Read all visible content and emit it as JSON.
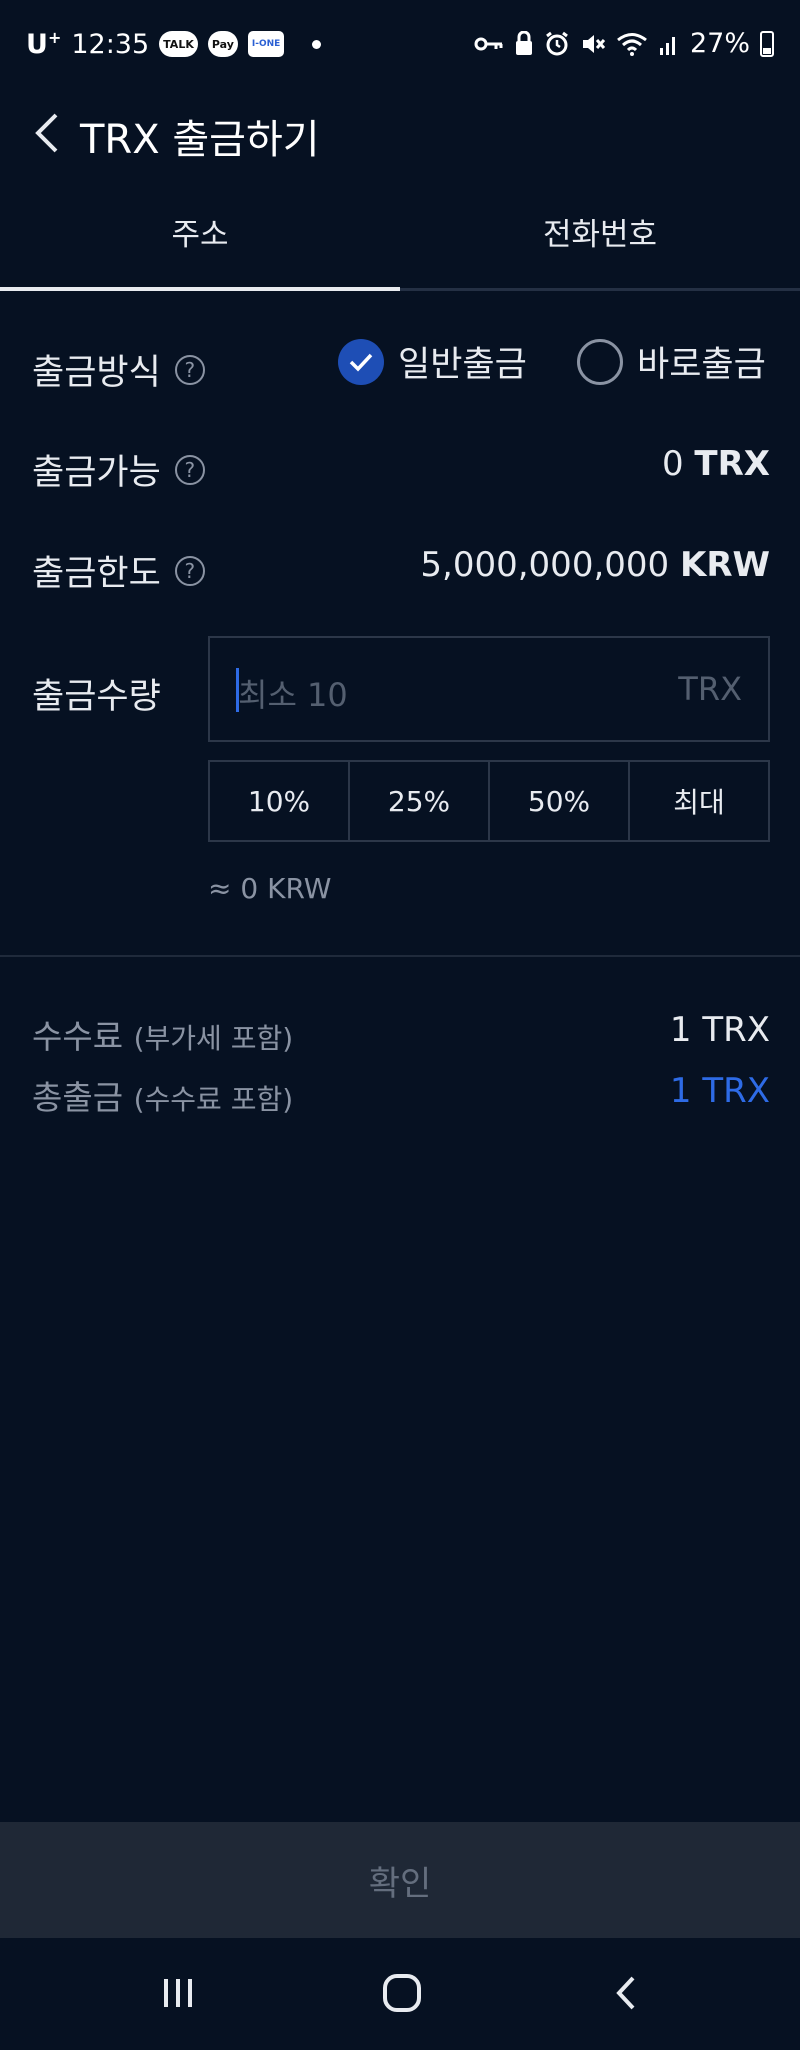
{
  "status_bar": {
    "carrier": "U",
    "carrier_sup": "+",
    "time": "12:35",
    "app_icons": [
      "TALK",
      "Pay",
      "I-ONE"
    ],
    "battery": "27%"
  },
  "header": {
    "title": "TRX 출금하기"
  },
  "tabs": [
    {
      "label": "주소",
      "active": true
    },
    {
      "label": "전화번호",
      "active": false
    }
  ],
  "withdraw_method": {
    "label": "출금방식",
    "options": [
      {
        "label": "일반출금",
        "selected": true
      },
      {
        "label": "바로출금",
        "selected": false
      }
    ]
  },
  "available": {
    "label": "출금가능",
    "amount": "0",
    "unit": "TRX"
  },
  "limit": {
    "label": "출금한도",
    "amount": "5,000,000,000",
    "unit": "KRW"
  },
  "amount": {
    "label": "출금수량",
    "placeholder": "최소 10",
    "unit": "TRX",
    "percent_buttons": [
      "10%",
      "25%",
      "50%",
      "최대"
    ],
    "krw_estimate": "≈ 0 KRW"
  },
  "fee": {
    "label": "수수료",
    "sub": "(부가세 포함)",
    "value": "1 TRX"
  },
  "total": {
    "label": "총출금",
    "sub": "(수수료 포함)",
    "value": "1 TRX"
  },
  "confirm_label": "확인",
  "colors": {
    "background": "#061122",
    "accent": "#2e6be6",
    "radio_on": "#1e4eb5",
    "confirm_bg": "#1f2836"
  }
}
